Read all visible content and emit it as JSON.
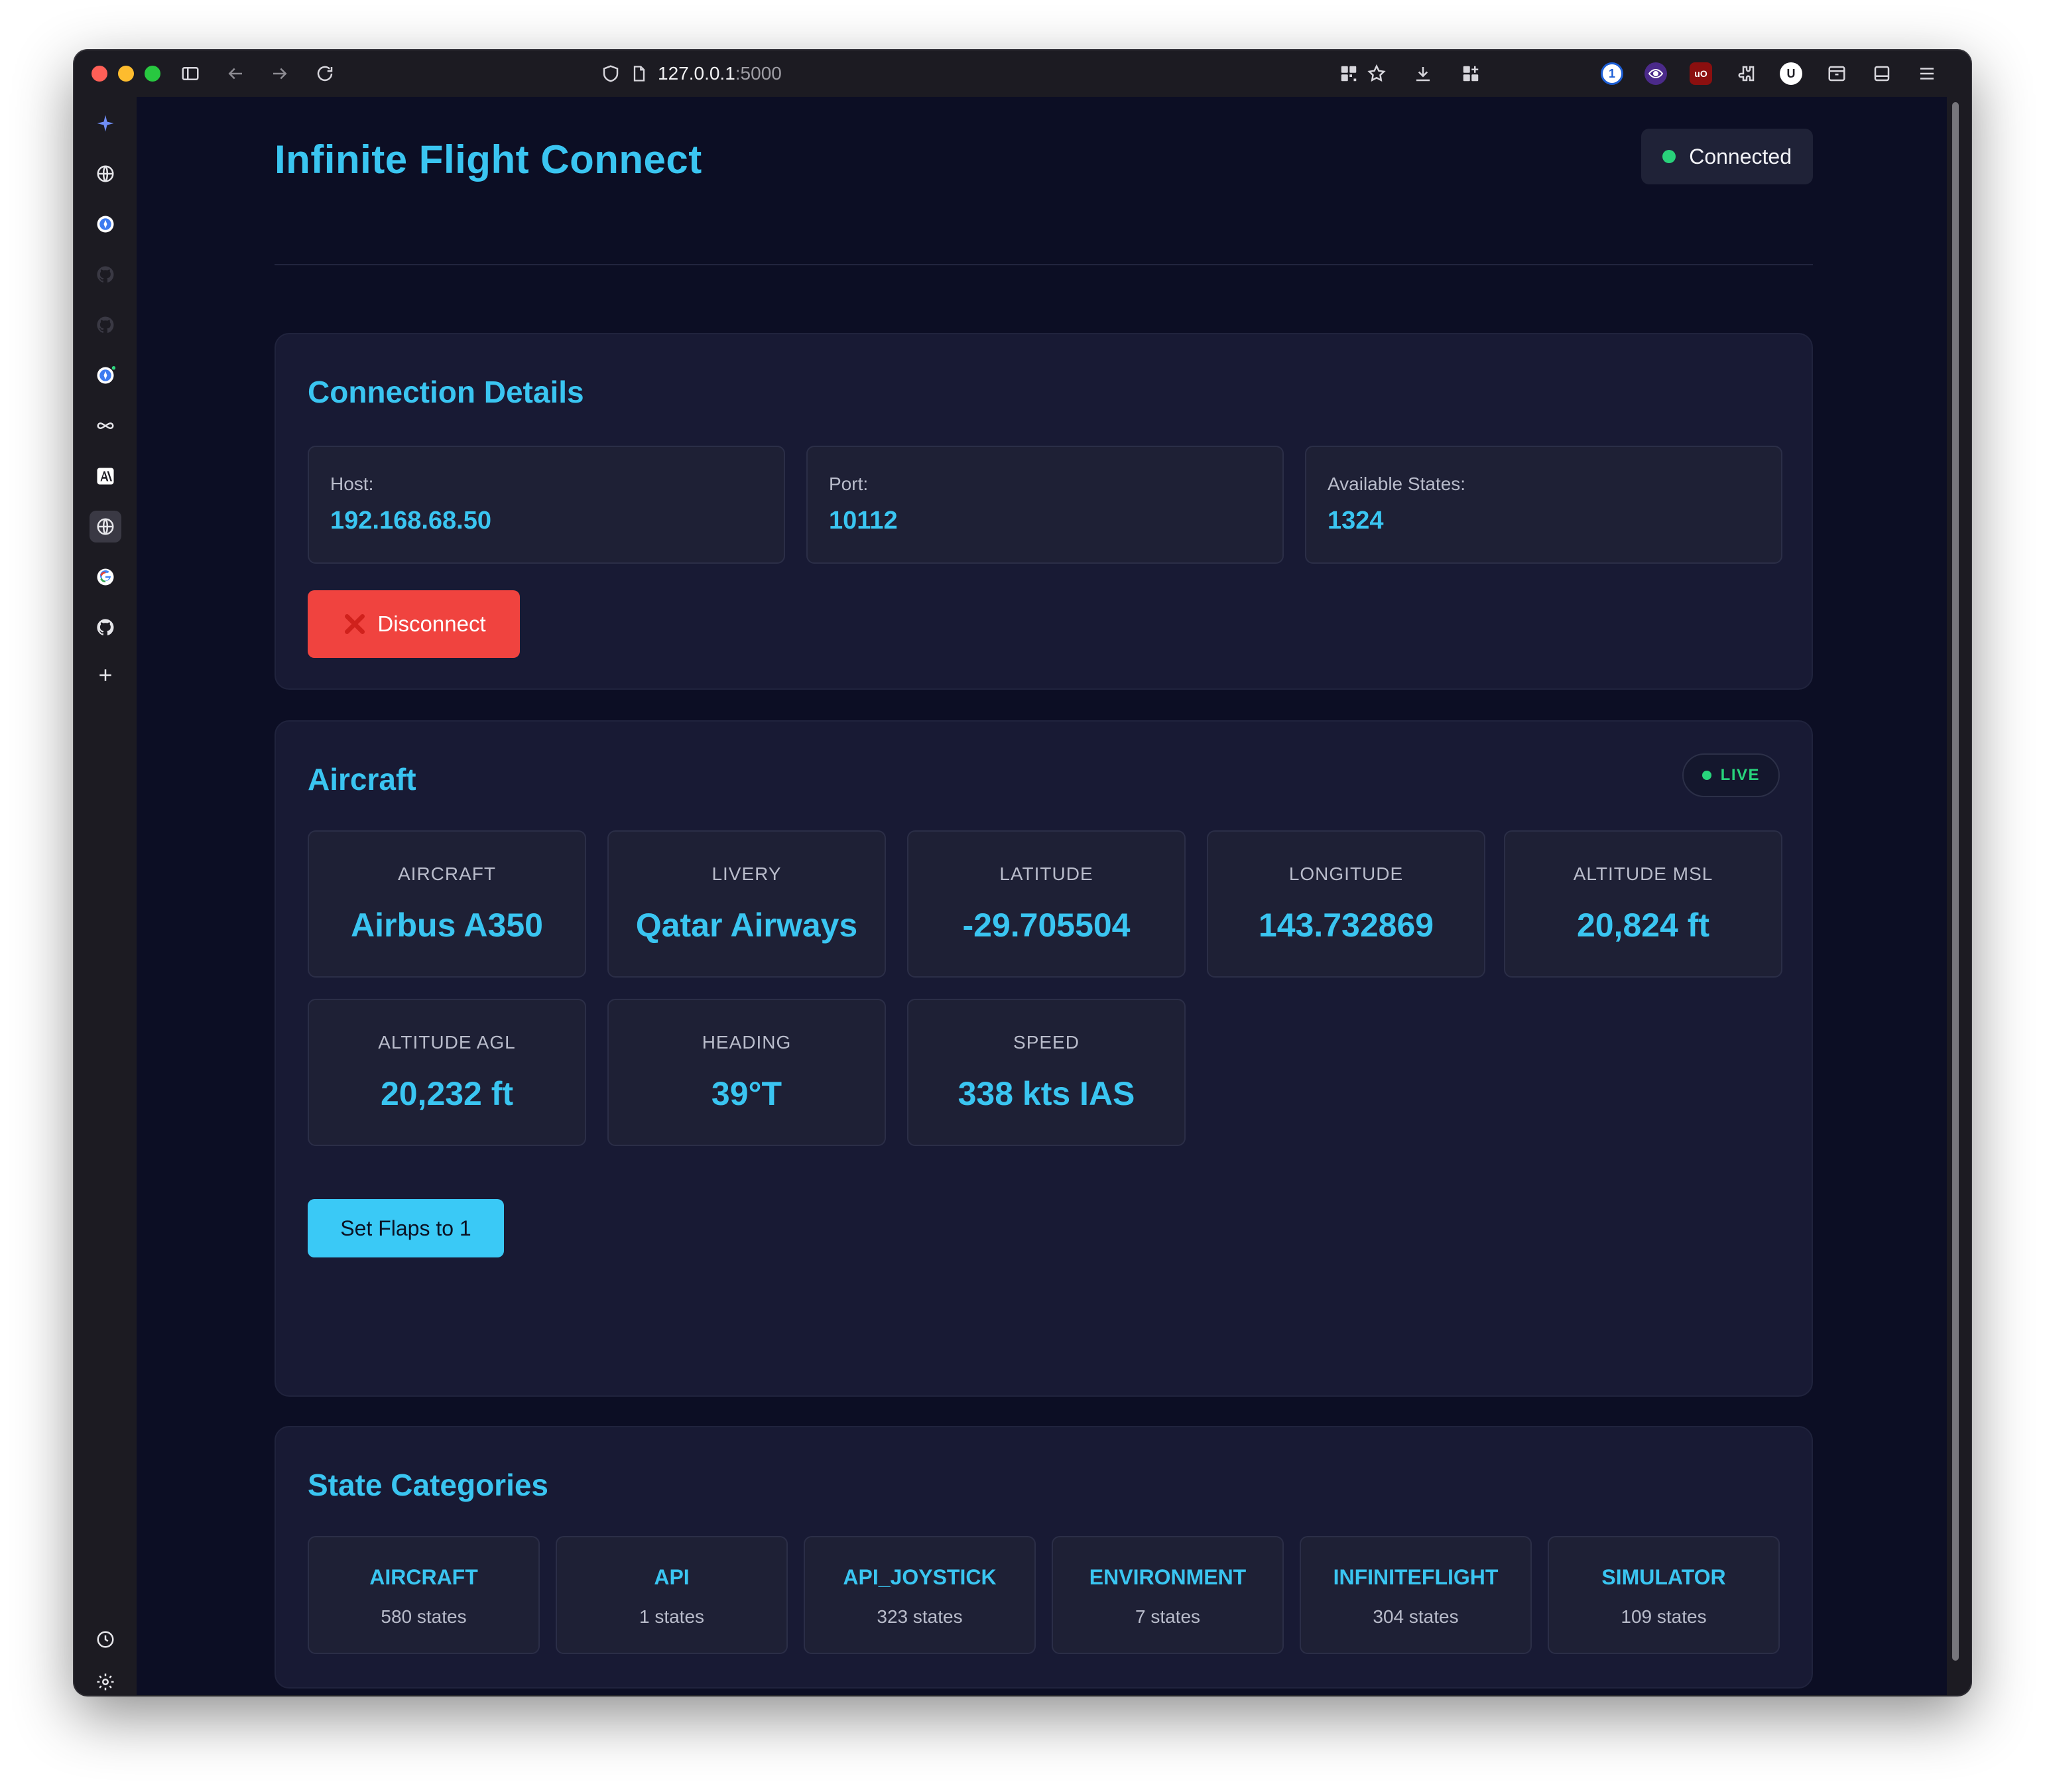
{
  "browser": {
    "url_host": "127.0.0.1",
    "url_port": ":5000"
  },
  "app": {
    "title": "Infinite Flight Connect",
    "status": "Connected"
  },
  "connection_details": {
    "title": "Connection Details",
    "host_label": "Host:",
    "host_value": "192.168.68.50",
    "port_label": "Port:",
    "port_value": "10112",
    "states_label": "Available States:",
    "states_value": "1324",
    "disconnect_label": "Disconnect"
  },
  "aircraft": {
    "title": "Aircraft",
    "live_badge": "LIVE",
    "stats": [
      {
        "label": "AIRCRAFT",
        "value": "Airbus A350"
      },
      {
        "label": "LIVERY",
        "value": "Qatar Airways"
      },
      {
        "label": "LATITUDE",
        "value": "-29.705504"
      },
      {
        "label": "LONGITUDE",
        "value": "143.732869"
      },
      {
        "label": "ALTITUDE MSL",
        "value": "20,824 ft"
      },
      {
        "label": "ALTITUDE AGL",
        "value": "20,232 ft"
      },
      {
        "label": "HEADING",
        "value": "39°T"
      },
      {
        "label": "SPEED",
        "value": "338 kts IAS"
      }
    ],
    "flaps_button": "Set Flaps to 1"
  },
  "state_categories": {
    "title": "State Categories",
    "items": [
      {
        "name": "AIRCRAFT",
        "count": "580 states"
      },
      {
        "name": "API",
        "count": "1 states"
      },
      {
        "name": "API_JOYSTICK",
        "count": "323 states"
      },
      {
        "name": "ENVIRONMENT",
        "count": "7 states"
      },
      {
        "name": "INFINITEFLIGHT",
        "count": "304 states"
      },
      {
        "name": "SIMULATOR",
        "count": "109 states"
      }
    ]
  },
  "extensions": {
    "ext_1": "1",
    "ext_ublock": "uO",
    "ext_u": "U"
  },
  "colors": {
    "accent": "#3ac5f1",
    "background": "#0c0e24",
    "card": "#181a34",
    "danger": "#f0433f",
    "success": "#29d17a"
  }
}
